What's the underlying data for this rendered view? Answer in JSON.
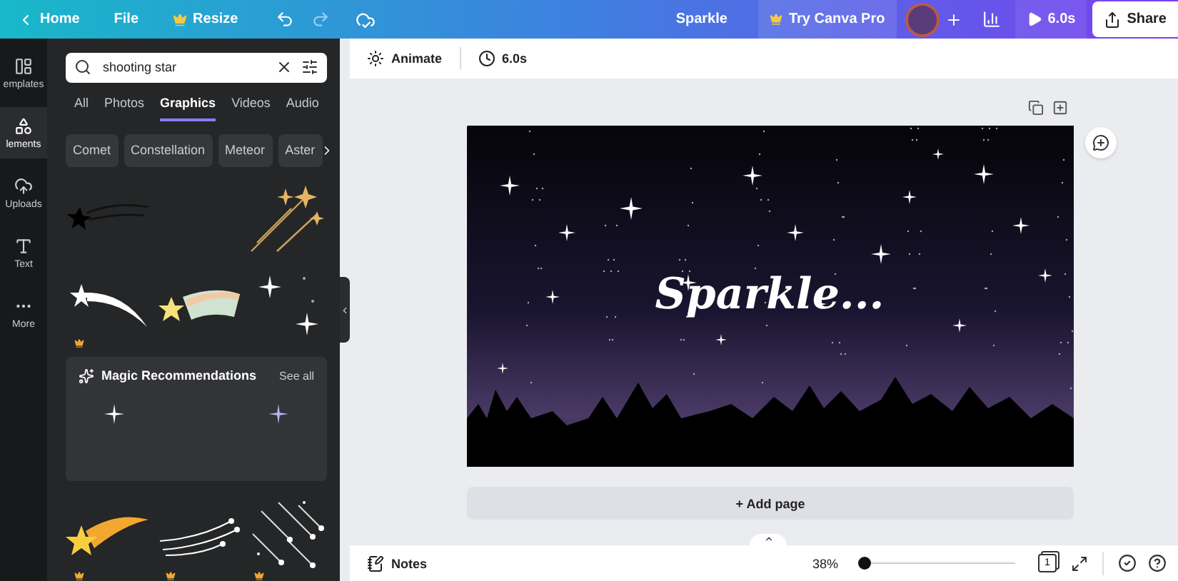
{
  "topbar": {
    "home": "Home",
    "file": "File",
    "resize": "Resize",
    "title": "Sparkle",
    "pro": "Try Canva Pro",
    "play": "6.0s",
    "share": "Share"
  },
  "rail": [
    {
      "label": "emplates",
      "kind": "templates",
      "selected": false
    },
    {
      "label": "lements",
      "kind": "elements",
      "selected": true
    },
    {
      "label": "Uploads",
      "kind": "uploads",
      "selected": false
    },
    {
      "label": "Text",
      "kind": "text",
      "selected": false
    },
    {
      "label": "More",
      "kind": "more",
      "selected": false
    }
  ],
  "search": {
    "value": "shooting star"
  },
  "tabs": [
    {
      "label": "All",
      "selected": false
    },
    {
      "label": "Photos",
      "selected": false
    },
    {
      "label": "Graphics",
      "selected": true
    },
    {
      "label": "Videos",
      "selected": false
    },
    {
      "label": "Audio",
      "selected": false
    }
  ],
  "chips": [
    "Comet",
    "Constellation",
    "Meteor",
    "Aster"
  ],
  "magic": {
    "title": "Magic Recommendations",
    "link": "See all"
  },
  "toolbar": {
    "animate": "Animate",
    "duration": "6.0s"
  },
  "canvas": {
    "headline": "Sparkle..."
  },
  "add_page": "+ Add page",
  "bottom": {
    "notes": "Notes",
    "zoom": "38%",
    "zoom_slider": {
      "level": 0.04
    },
    "page_count": "1"
  }
}
